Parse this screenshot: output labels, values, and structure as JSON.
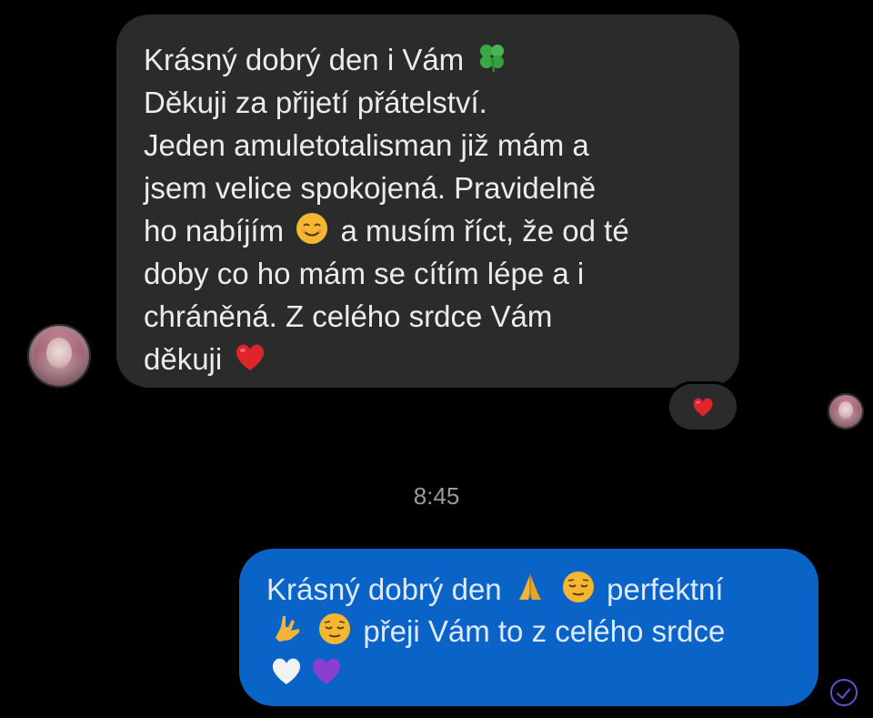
{
  "incoming_message": {
    "lines": [
      "Krásný dobrý den i Vám",
      "Děkuji za přijetí přátelství.",
      "Jeden amuletotalisman již mám a",
      "jsem velice spokojená. Pravidelně",
      "ho nabíjím",
      "a musím říct, že od té",
      "doby co ho mám se cítím lépe a i",
      "chráněná. Z celého srdce Vám",
      "děkuji"
    ],
    "emojis": {
      "line1": "four-leaf-clover-emoji",
      "line5": "smiling-face-emoji",
      "line9": "red-heart-emoji"
    },
    "reaction": "red-heart-emoji"
  },
  "timestamp": "8:45",
  "outgoing_message": {
    "line1_text_a": "Krásný dobrý den",
    "line1_text_b": "perfektní",
    "line2_text": "přeji Vám to z celého srdce",
    "emojis": [
      "folded-hands-emoji",
      "relieved-face-emoji",
      "love-you-gesture-emoji",
      "relieved-face-emoji",
      "white-heart-emoji",
      "purple-heart-emoji"
    ]
  },
  "colors": {
    "incoming_bubble": "#2b2b2b",
    "outgoing_bubble": "#0a63c7",
    "background": "#000000",
    "seen_indicator": "#6a4fc9"
  }
}
